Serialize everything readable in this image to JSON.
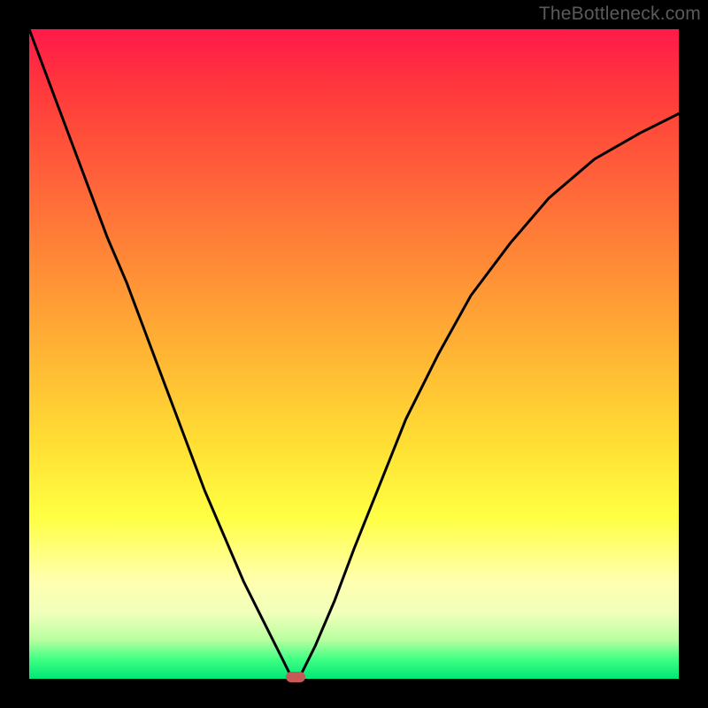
{
  "watermark": "TheBottleneck.com",
  "colors": {
    "frame": "#000000",
    "curve": "#000000",
    "marker": "#c65a56"
  },
  "chart_data": {
    "type": "line",
    "title": "",
    "xlabel": "",
    "ylabel": "",
    "xlim": [
      0,
      100
    ],
    "ylim": [
      0,
      100
    ],
    "grid": false,
    "legend": false,
    "background_gradient": {
      "orientation": "vertical",
      "stops": [
        {
          "pos": 0.0,
          "color": "#ff1a4a"
        },
        {
          "pos": 0.5,
          "color": "#ffb534"
        },
        {
          "pos": 0.75,
          "color": "#ffff42"
        },
        {
          "pos": 1.0,
          "color": "#00e676"
        }
      ]
    },
    "series": [
      {
        "name": "bottleneck-curve",
        "x": [
          0,
          3,
          6,
          9,
          12,
          15,
          18,
          21,
          24,
          27,
          30,
          33,
          36,
          39,
          40,
          41,
          42,
          44,
          47,
          50,
          54,
          58,
          63,
          68,
          74,
          80,
          87,
          94,
          100
        ],
        "y": [
          100,
          92,
          84,
          76,
          68,
          61,
          53,
          45,
          37,
          29,
          22,
          15,
          9,
          3,
          1,
          0,
          1,
          5,
          12,
          20,
          30,
          40,
          50,
          59,
          67,
          74,
          80,
          84,
          87
        ]
      }
    ],
    "marker": {
      "x": 41,
      "y": 0,
      "shape": "rounded-rect",
      "color": "#c65a56"
    }
  }
}
